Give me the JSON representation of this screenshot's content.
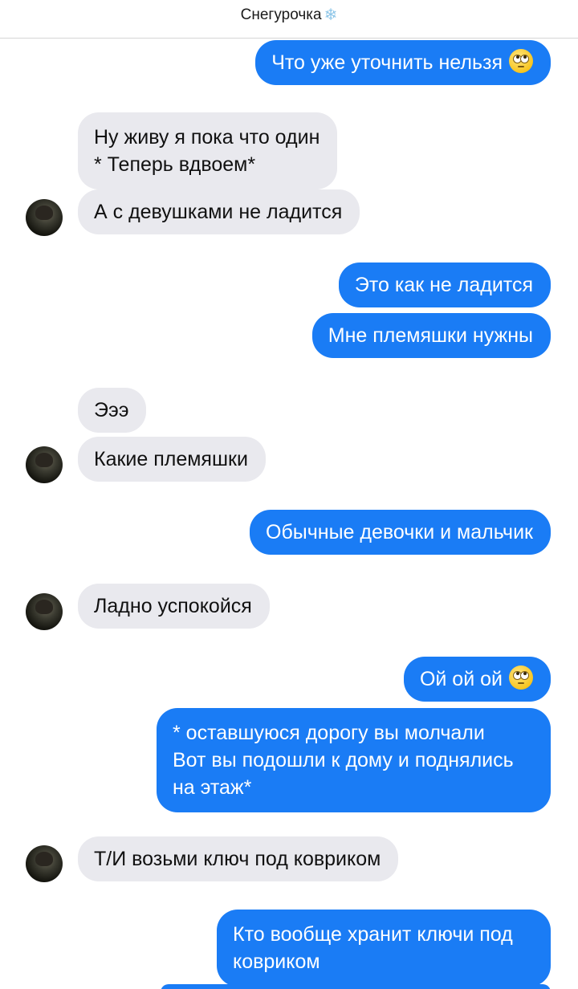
{
  "header": {
    "title": "Снегурочка",
    "title_icon": "snowflake-icon"
  },
  "messages": [
    {
      "id": 0,
      "side": "outgoing",
      "text": "Что уже уточнить нельзя",
      "emoji": "face-with-rolling-eyes"
    },
    {
      "id": 1,
      "side": "incoming",
      "lines": [
        "Ну живу я пока что один",
        "* Теперь вдвоем*"
      ]
    },
    {
      "id": 2,
      "side": "incoming",
      "text": "А с девушками не ладится",
      "avatar": true
    },
    {
      "id": 3,
      "side": "outgoing",
      "text": "Это как не ладится"
    },
    {
      "id": 4,
      "side": "outgoing",
      "text": "Мне племяшки нужны"
    },
    {
      "id": 5,
      "side": "incoming",
      "text": "Эээ"
    },
    {
      "id": 6,
      "side": "incoming",
      "text": "Какие племяшки",
      "avatar": true
    },
    {
      "id": 7,
      "side": "outgoing",
      "text": "Обычные девочки и мальчик"
    },
    {
      "id": 8,
      "side": "incoming",
      "text": "Ладно успокойся",
      "avatar": true
    },
    {
      "id": 9,
      "side": "outgoing",
      "text": "Ой ой ой",
      "emoji": "face-with-rolling-eyes"
    },
    {
      "id": 10,
      "side": "outgoing",
      "lines": [
        "* оставшуюся дорогу вы молчали",
        "Вот вы подошли к дому и поднялись",
        "на этаж*"
      ]
    },
    {
      "id": 11,
      "side": "incoming",
      "text": "Т/И возьми ключ под ковриком",
      "avatar": true
    },
    {
      "id": 12,
      "side": "outgoing",
      "lines": [
        "Кто вообще хранит ключи под",
        "ковриком"
      ]
    }
  ],
  "colors": {
    "outgoing_bubble": "#1a7cf5",
    "incoming_bubble": "#e9e9ee",
    "outgoing_text": "#ffffff",
    "incoming_text": "#111111"
  }
}
